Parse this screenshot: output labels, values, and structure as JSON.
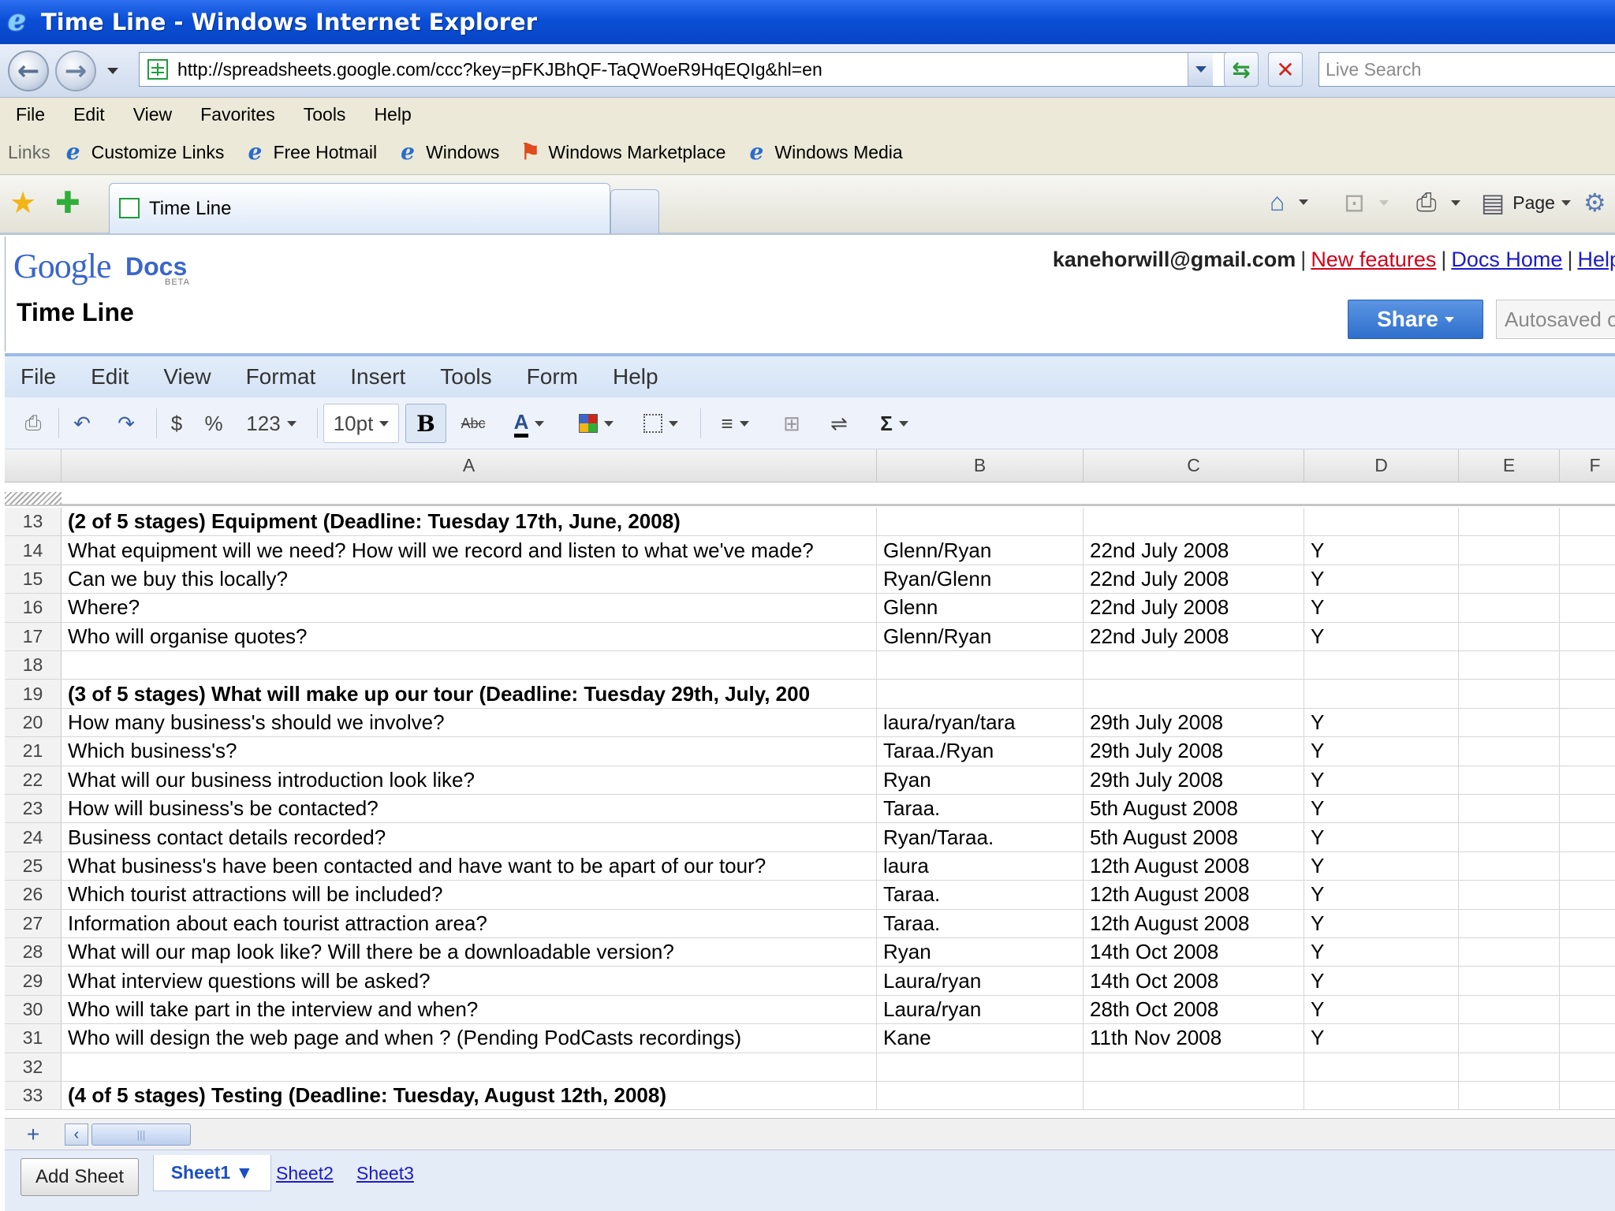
{
  "window": {
    "title": "Time Line - Windows Internet Explorer"
  },
  "address_bar": {
    "url": "http://spreadsheets.google.com/ccc?key=pFKJBhQF-TaQWoeR9HqEQIg&hl=en",
    "search_placeholder": "Live Search"
  },
  "ie_menu": [
    "File",
    "Edit",
    "View",
    "Favorites",
    "Tools",
    "Help"
  ],
  "links_bar": {
    "label": "Links",
    "items": [
      "Customize Links",
      "Free Hotmail",
      "Windows",
      "Windows Marketplace",
      "Windows Media"
    ]
  },
  "tabs": {
    "active": "Time Line"
  },
  "command_bar": {
    "page_label": "Page"
  },
  "docs": {
    "logo_google": "Google",
    "logo_docs": "Docs",
    "logo_beta": "BETA",
    "doc_title": "Time Line",
    "email": "kanehorwill@gmail.com",
    "links": {
      "new_features": "New features",
      "docs_home": "Docs Home",
      "help": "Help"
    },
    "share_label": "Share",
    "autosaved": "Autosaved on"
  },
  "app_menu": [
    "File",
    "Edit",
    "View",
    "Format",
    "Insert",
    "Tools",
    "Form",
    "Help"
  ],
  "toolbar": {
    "currency": "$",
    "percent": "%",
    "number_format": "123",
    "font_size": "10pt",
    "bold": "B",
    "strike": "Abc",
    "text_color": "A",
    "sum": "Σ"
  },
  "columns": [
    "A",
    "B",
    "C",
    "D",
    "E",
    "F"
  ],
  "rows": [
    {
      "num": "13",
      "a": "(2 of 5 stages) Equipment (Deadline: Tuesday 17th, June, 2008)",
      "b": "",
      "c": "",
      "d": "",
      "bold": true
    },
    {
      "num": "14",
      "a": "What equipment will we need? How will we record and listen to what we've made?",
      "b": "Glenn/Ryan",
      "c": "22nd July 2008",
      "d": "Y"
    },
    {
      "num": "15",
      "a": "Can we buy this locally?",
      "b": "Ryan/Glenn",
      "c": "22nd July 2008",
      "d": "Y"
    },
    {
      "num": "16",
      "a": "Where?",
      "b": "Glenn",
      "c": "22nd July 2008",
      "d": "Y"
    },
    {
      "num": "17",
      "a": "Who will organise quotes?",
      "b": "Glenn/Ryan",
      "c": "22nd July 2008",
      "d": "Y"
    },
    {
      "num": "18",
      "a": "",
      "b": "",
      "c": "",
      "d": ""
    },
    {
      "num": "19",
      "a": "(3 of 5 stages) What will make up our tour (Deadline: Tuesday 29th, July, 200",
      "b": "",
      "c": "",
      "d": "",
      "bold": true
    },
    {
      "num": "20",
      "a": "How many business's should we involve?",
      "b": "laura/ryan/tara",
      "c": "29th July 2008",
      "d": "Y"
    },
    {
      "num": "21",
      "a": "Which business's?",
      "b": "Taraa./Ryan",
      "c": "29th July 2008",
      "d": "Y"
    },
    {
      "num": "22",
      "a": "What will our business introduction look like?",
      "b": "Ryan",
      "c": "29th July 2008",
      "d": "Y"
    },
    {
      "num": "23",
      "a": "How will business's be contacted?",
      "b": "Taraa.",
      "c": "5th August 2008",
      "d": "Y"
    },
    {
      "num": "24",
      "a": "Business contact details recorded?",
      "b": "Ryan/Taraa.",
      "c": "5th August 2008",
      "d": "Y"
    },
    {
      "num": "25",
      "a": "What business's have been contacted and have want to be apart of our tour?",
      "b": "laura",
      "c": "12th August 2008",
      "d": "Y"
    },
    {
      "num": "26",
      "a": "Which tourist attractions will be included?",
      "b": "Taraa.",
      "c": "12th August 2008",
      "d": "Y"
    },
    {
      "num": "27",
      "a": "Information about each tourist attraction area?",
      "b": "Taraa.",
      "c": "12th August 2008",
      "d": "Y"
    },
    {
      "num": "28",
      "a": "What will our map look like? Will there be a downloadable version?",
      "b": "Ryan",
      "c": "14th Oct 2008",
      "d": "Y"
    },
    {
      "num": "29",
      "a": "What interview questions will be asked?",
      "b": "Laura/ryan",
      "c": "14th Oct 2008",
      "d": "Y"
    },
    {
      "num": "30",
      "a": "Who will take part in the interview and when?",
      "b": "Laura/ryan",
      "c": "28th Oct 2008",
      "d": "Y"
    },
    {
      "num": "31",
      "a": "Who will design the web page and when ? (Pending PodCasts recordings)",
      "b": "Kane",
      "c": "11th Nov 2008",
      "d": "Y"
    },
    {
      "num": "32",
      "a": "",
      "b": "",
      "c": "",
      "d": ""
    },
    {
      "num": "33",
      "a": "(4 of 5 stages) Testing (Deadline: Tuesday, August 12th, 2008)",
      "b": "",
      "c": "",
      "d": "",
      "bold": true
    }
  ],
  "sheet_bar": {
    "add_sheet": "Add Sheet",
    "sheets": [
      "Sheet1 ▼",
      "Sheet2",
      "Sheet3"
    ],
    "add_row": "+"
  }
}
